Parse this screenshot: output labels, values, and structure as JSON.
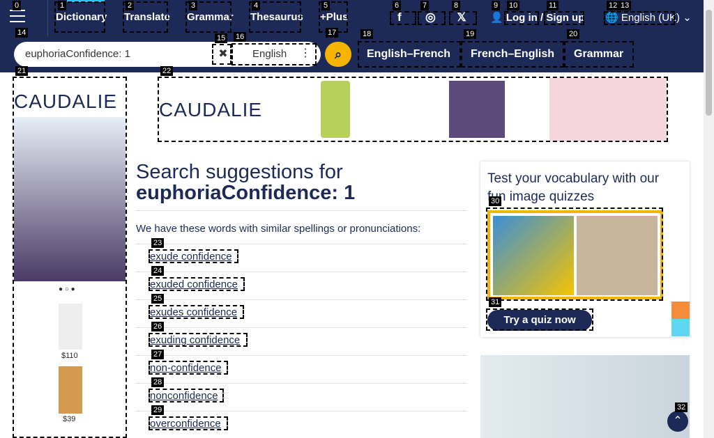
{
  "nav": {
    "items": [
      "Dictionary",
      "Translate",
      "Grammar",
      "Thesaurus",
      "+Plus"
    ],
    "login": "Log in",
    "slash": "/",
    "signup": "Sign up",
    "language": "English (UK)"
  },
  "search": {
    "query": "euphoriaConfidence: 1",
    "language": "English",
    "tabs": [
      "English–French",
      "French–English",
      "Grammar"
    ]
  },
  "main": {
    "title_prefix": "Search suggestions for",
    "title_term": "euphoriaConfidence: 1",
    "intro": "We have these words with similar spellings or pronunciations:",
    "suggestions": [
      "exude confidence",
      "exuded confidence",
      "exudes confidence",
      "exuding confidence",
      "non-confidence",
      "nonconfidence",
      "overconfidence"
    ]
  },
  "quiz": {
    "title": "Test your vocabulary with our fun image quizzes",
    "button": "Try a quiz now"
  },
  "ads": {
    "brand": "CAUDALIE",
    "prices": [
      "$110",
      "$39"
    ]
  },
  "tags": [
    "0",
    "1",
    "2",
    "3",
    "4",
    "5",
    "6",
    "7",
    "8",
    "9",
    "10",
    "11",
    "12",
    "13",
    "14",
    "15",
    "16",
    "17",
    "18",
    "19",
    "20",
    "21",
    "22",
    "23",
    "24",
    "25",
    "26",
    "27",
    "28",
    "29",
    "30",
    "31",
    "32"
  ],
  "colors": {
    "navy": "#1d2a57",
    "accent": "#f5b400",
    "highlight": "#2bc5f0"
  }
}
